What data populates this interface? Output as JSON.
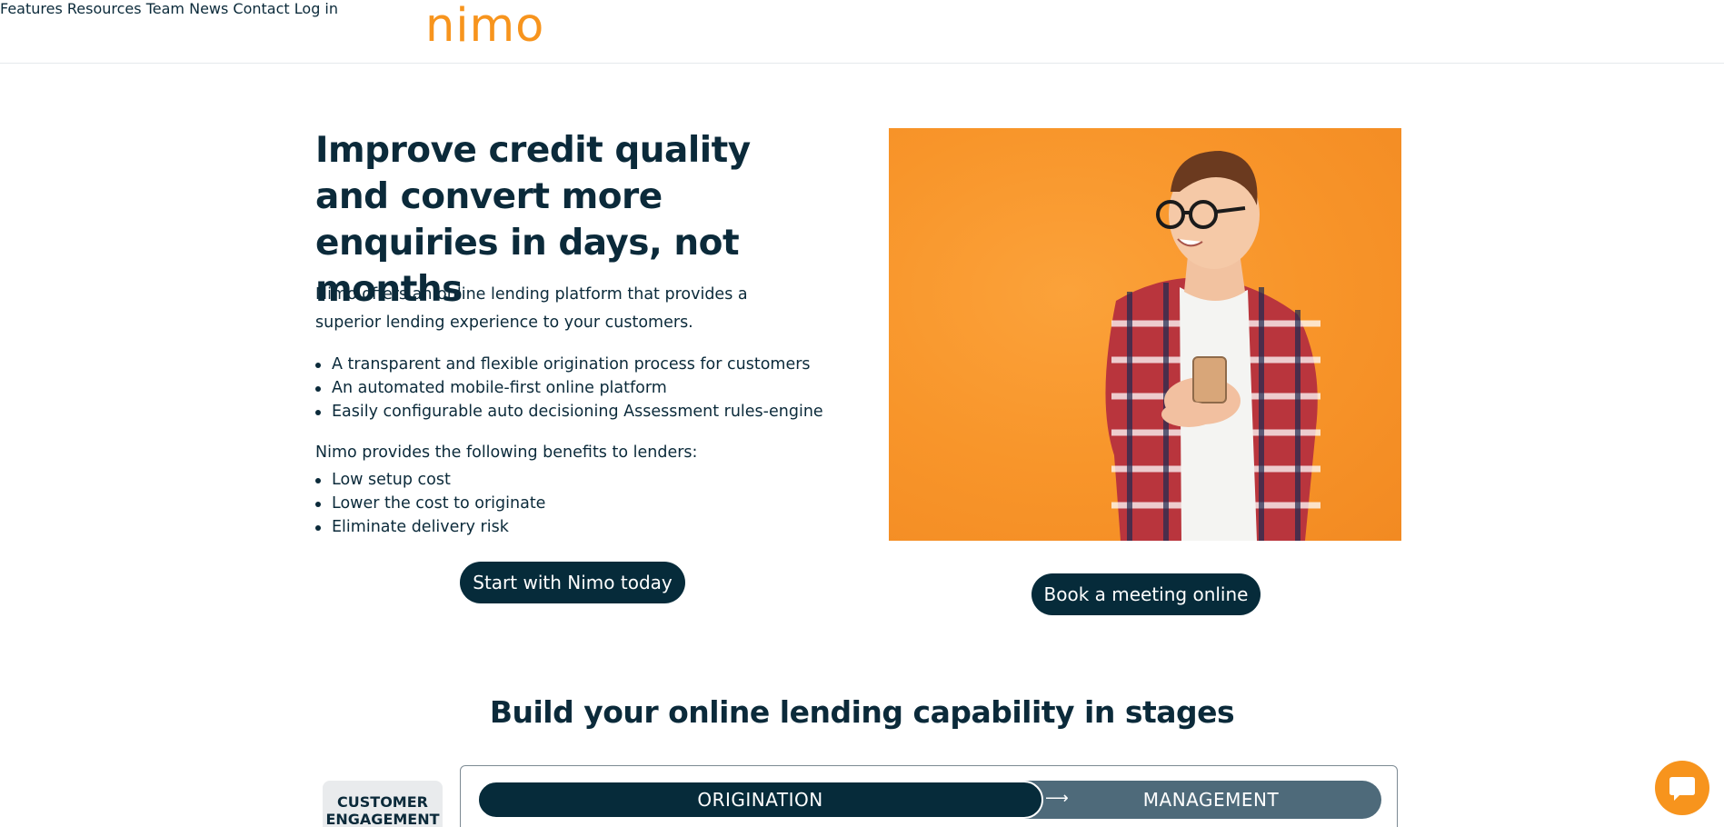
{
  "header": {
    "logo": "nimo",
    "nav": [
      "Features",
      "Resources",
      "Team",
      "News",
      "Contact",
      "Log in"
    ]
  },
  "hero": {
    "title": "Improve credit quality and convert more enquiries in days, not months",
    "intro": "Nimo offers an online lending platform that provides a superior lending experience to your customers.",
    "features": [
      "A transparent and flexible origination process for customers",
      "An automated mobile-first online platform",
      "Easily configurable auto decisioning Assessment rules-engine"
    ],
    "benefits_intro": "Nimo provides the following benefits to lenders:",
    "benefits": [
      "Low setup cost",
      "Lower the cost to originate",
      "Eliminate delivery risk"
    ],
    "cta_start": "Start with Nimo today",
    "cta_book": "Book a meeting online",
    "image_icon": "person-with-phone-photo"
  },
  "stages": {
    "title": "Build your online lending capability in stages",
    "customer_engagement": "CUSTOMER ENGAGEMENT",
    "origination": "ORIGINATION",
    "management": "MANAGEMENT"
  },
  "chat": {
    "icon": "chat-bubble-icon"
  },
  "colors": {
    "brand_orange": "#f7941d",
    "navy": "#062b3a",
    "slate": "#4e6a7a"
  }
}
